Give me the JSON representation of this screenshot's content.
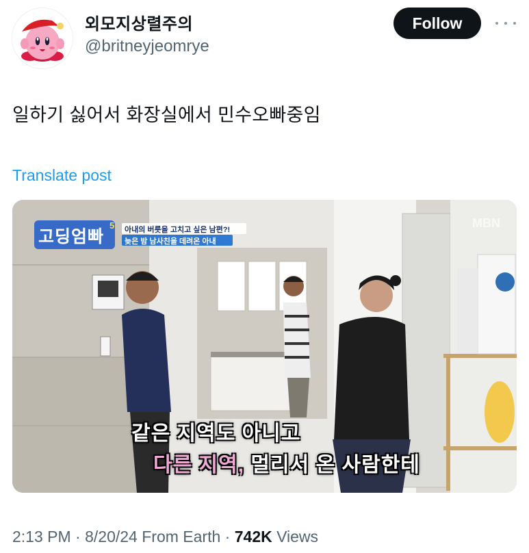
{
  "author": {
    "display_name": "외모지상렬주의",
    "handle": "@britneyjeomrye"
  },
  "follow_label": "Follow",
  "tweet": {
    "text": "일하기 싫어서 화장실에서 민수오빠중임",
    "translate_label": "Translate post"
  },
  "media": {
    "show_logo": "고딩엄빠",
    "show_season": "5",
    "caption_top": "아내의 버릇을 고치고 싶은 남편?!",
    "caption_bottom": "늦은 밤 남사친을 데려온 아내",
    "channel_logo": "MBN",
    "subtitle_line1": "같은 지역도 아니고",
    "subtitle_line2_highlight": "다른 지역,",
    "subtitle_line2_rest": "멀리서 온 사람한테"
  },
  "meta": {
    "time": "2:13 PM",
    "sep1": "·",
    "date": "8/20/24",
    "source": "From Earth",
    "sep2": "·",
    "views_count": "742K",
    "views_label": "Views"
  },
  "colors": {
    "follow_bg": "#0f1419",
    "link_blue": "#1d9bf0",
    "secondary_text": "#536471",
    "subtitle_highlight": "#f2a8d6"
  }
}
